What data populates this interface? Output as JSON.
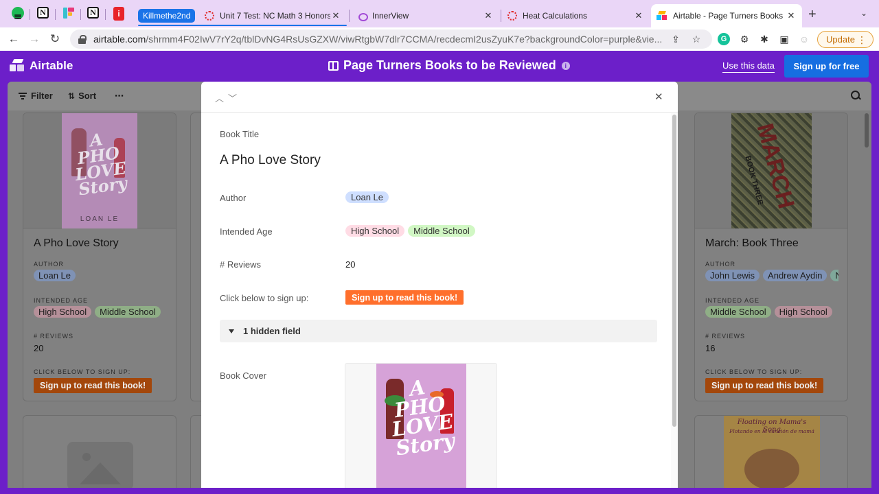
{
  "browser": {
    "tab_group_label": "Killmethe2nd",
    "tabs": [
      {
        "title": "Unit 7 Test: NC Math 3 Honors"
      },
      {
        "title": "InnerView"
      },
      {
        "title": "Heat Calculations"
      },
      {
        "title": "Airtable - Page Turners Books"
      }
    ],
    "url_main": "airtable.com",
    "url_rest": "/shrmm4F02IwV7rY2q/tblDvNG4RsUsGZXW/viwRtgbW7dlr7CCMA/recdecmI2usZyuK7e?backgroundColor=purple&vie...",
    "update_label": "Update",
    "pinned_notion_glyph": "N",
    "pinned_red_glyph": "i"
  },
  "airtable": {
    "logo": "Airtable",
    "base_title": "Page Turners Books to be Reviewed",
    "use_data": "Use this data",
    "sign_up_free": "Sign up for free",
    "brand_color": "#6c1fc9"
  },
  "view_toolbar": {
    "filter": "Filter",
    "sort": "Sort",
    "more": "⋯"
  },
  "cards": [
    {
      "title": "A Pho Love Story",
      "author_label": "AUTHOR",
      "authors": [
        "Loan Le"
      ],
      "age_label": "INTENDED AGE",
      "ages": [
        "High School",
        "Middle School"
      ],
      "reviews_label": "# REVIEWS",
      "reviews": "20",
      "signup_label": "CLICK BELOW TO SIGN UP:",
      "button": "Sign up to read this book!"
    },
    {
      "title": "March: Book Three",
      "author_label": "AUTHOR",
      "authors": [
        "John Lewis",
        "Andrew Aydin",
        "N"
      ],
      "age_label": "INTENDED AGE",
      "ages": [
        "Middle School",
        "High School"
      ],
      "reviews_label": "# REVIEWS",
      "reviews": "16",
      "signup_label": "CLICK BELOW TO SIGN UP:",
      "button": "Sign up to read this book!"
    }
  ],
  "covers": {
    "pho_title_lines": [
      "A",
      "PHO",
      "LOVE",
      "Story"
    ],
    "pho_author": "LOAN LE",
    "march_title": "MARCH",
    "march_sub": "BOOK THREE",
    "song_title": "Floating on Mama's Song",
    "song_sub": "Flotando en la canción de mamá"
  },
  "record": {
    "book_title_label": "Book Title",
    "book_title": "A Pho Love Story",
    "author_label": "Author",
    "author": "Loan Le",
    "age_label": "Intended Age",
    "ages": [
      "High School",
      "Middle School"
    ],
    "reviews_label": "# Reviews",
    "reviews": "20",
    "signup_label": "Click below to sign up:",
    "signup_button": "Sign up to read this book!",
    "hidden_fields": "1 hidden field",
    "cover_label": "Book Cover"
  }
}
